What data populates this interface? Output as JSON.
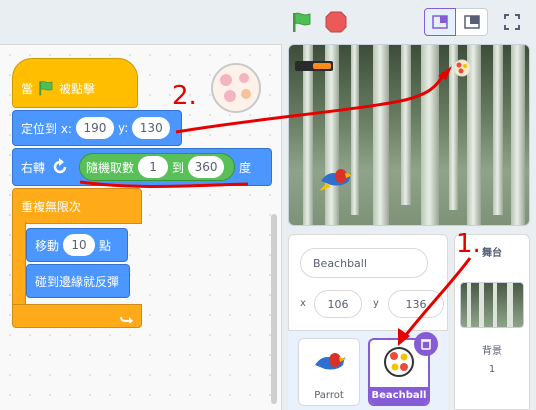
{
  "code": {
    "hat_label": "當",
    "hat_suffix": "被點擊",
    "goto_label": "定位到 x:",
    "goto_x": "190",
    "goto_y_label": "y:",
    "goto_y": "130",
    "turn_label": "右轉",
    "random_label": "隨機取數",
    "random_from": "1",
    "random_to_label": "到",
    "random_to": "360",
    "degree_label": "度",
    "forever_label": "重複無限次",
    "move_label": "移動",
    "move_steps": "10",
    "move_unit": "點",
    "bounce_label": "碰到邊緣就反彈"
  },
  "annotations": {
    "step1": "1.",
    "step2": "2."
  },
  "sprite_info": {
    "name": "Beachball",
    "x_label": "x",
    "x_value": "106",
    "y_label": "y",
    "y_value": "136"
  },
  "sprites": [
    {
      "name": "Parrot"
    },
    {
      "name": "Beachball"
    }
  ],
  "stage_panel": {
    "header": "舞台",
    "backdrop_label": "背景",
    "backdrop_count": "1"
  },
  "colors": {
    "motion": "#4c97ff",
    "control": "#ffab19",
    "events": "#ffbf00",
    "operators": "#59c059",
    "selected": "#855cd6",
    "annotation": "#e60000"
  }
}
